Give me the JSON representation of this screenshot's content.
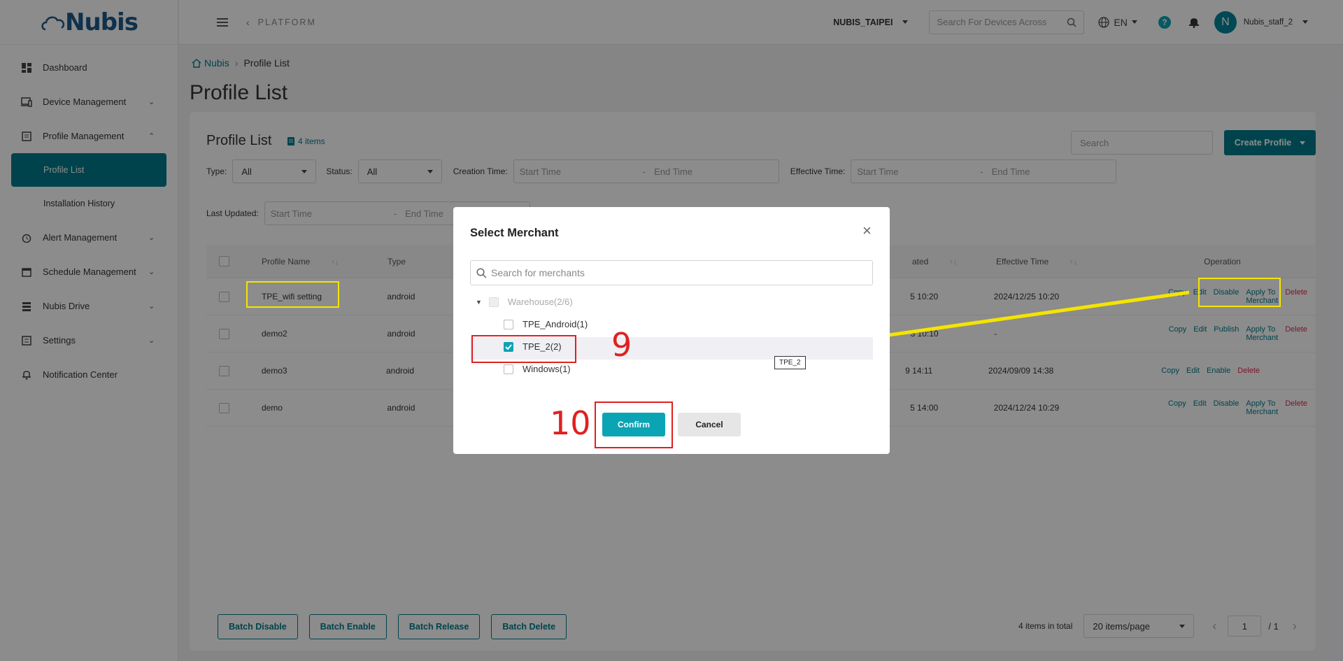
{
  "app": {
    "logo": "Nubis"
  },
  "sidebar": {
    "items": [
      {
        "label": "Dashboard",
        "icon": "dashboard-icon"
      },
      {
        "label": "Device Management",
        "icon": "device-icon"
      },
      {
        "label": "Profile Management",
        "icon": "profile-icon"
      },
      {
        "label": "Profile List",
        "icon": ""
      },
      {
        "label": "Installation History",
        "icon": ""
      },
      {
        "label": "Alert Management",
        "icon": "alarm-icon"
      },
      {
        "label": "Schedule Management",
        "icon": "calendar-icon"
      },
      {
        "label": "Nubis Drive",
        "icon": "drive-icon"
      },
      {
        "label": "Settings",
        "icon": "settings-icon"
      },
      {
        "label": "Notification Center",
        "icon": "bell-icon"
      }
    ]
  },
  "topbar": {
    "platform": "PLATFORM",
    "org": "NUBIS_TAIPEI",
    "search_placeholder": "Search For Devices Across",
    "lang": "EN",
    "help": "?",
    "avatar_letter": "N",
    "user": "Nubis_staff_2"
  },
  "breadcrumb": {
    "home": "Nubis",
    "current": "Profile List"
  },
  "page_title": "Profile List",
  "card": {
    "title": "Profile List",
    "count": "4 items",
    "search_placeholder": "Search",
    "create_label": "Create Profile"
  },
  "filters": {
    "type_label": "Type:",
    "type_value": "All",
    "status_label": "Status:",
    "status_value": "All",
    "creation_label": "Creation Time:",
    "effective_label": "Effective Time:",
    "updated_label": "Last Updated:",
    "start_placeholder": "Start Time",
    "end_placeholder": "End Time",
    "dash": "-"
  },
  "table": {
    "headers": {
      "name": "Profile Name",
      "type": "Type",
      "updated": "ated",
      "effective": "Effective Time",
      "operation": "Operation"
    },
    "rows": [
      {
        "name": "TPE_wifi setting",
        "type": "android",
        "updated": "5 10:20",
        "effective": "2024/12/25 10:20",
        "ops": [
          "Copy",
          "Edit",
          "Disable",
          "Apply To Merchant",
          "Delete"
        ]
      },
      {
        "name": "demo2",
        "type": "android",
        "updated": "3 10:10",
        "effective": "-",
        "ops": [
          "Copy",
          "Edit",
          "Publish",
          "Apply To Merchant",
          "Delete"
        ]
      },
      {
        "name": "demo3",
        "type": "android",
        "updated": "9 14:11",
        "effective": "2024/09/09 14:38",
        "ops": [
          "Copy",
          "Edit",
          "Enable",
          "Delete"
        ]
      },
      {
        "name": "demo",
        "type": "android",
        "updated": "5 14:00",
        "effective": "2024/12/24 10:29",
        "ops": [
          "Copy",
          "Edit",
          "Disable",
          "Apply To Merchant",
          "Delete"
        ]
      }
    ]
  },
  "batch": {
    "disable": "Batch Disable",
    "enable": "Batch Enable",
    "release": "Batch Release",
    "delete": "Batch Delete"
  },
  "pager": {
    "total": "4 items in total",
    "page_size": "20 items/page",
    "page": "1",
    "of": "/ 1"
  },
  "modal": {
    "title": "Select Merchant",
    "search_placeholder": "Search for merchants",
    "tree": {
      "root": "Warehouse(2/6)",
      "children": [
        {
          "label": "TPE_Android(1)",
          "checked": false
        },
        {
          "label": "TPE_2(2)",
          "checked": true
        },
        {
          "label": "Windows(1)",
          "checked": false
        }
      ]
    },
    "tooltip": "TPE_2",
    "confirm": "Confirm",
    "cancel": "Cancel"
  },
  "annotations": {
    "step9": "9",
    "step10": "10"
  },
  "colors": {
    "primary": "#007a8a",
    "accent": "#0aa4b5",
    "danger": "#e0284f",
    "highlight_yellow": "#f4e400",
    "highlight_red": "#e02020"
  }
}
